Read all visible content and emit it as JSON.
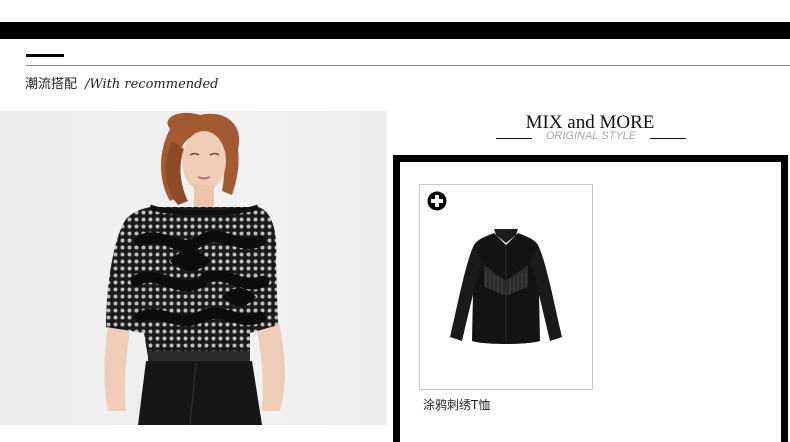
{
  "section": {
    "heading_cn": "潮流搭配",
    "heading_en": "/With recommended"
  },
  "mix": {
    "title": "MIX and MORE",
    "subtitle": "ORIGINAL STYLE"
  },
  "products": [
    {
      "name": "涂鸦刺绣T恤",
      "icon": "plus-circle-icon"
    }
  ],
  "colors": {
    "bar": "#000000",
    "photo_bg": "#efefef",
    "subtitle": "#a7a7a7"
  }
}
